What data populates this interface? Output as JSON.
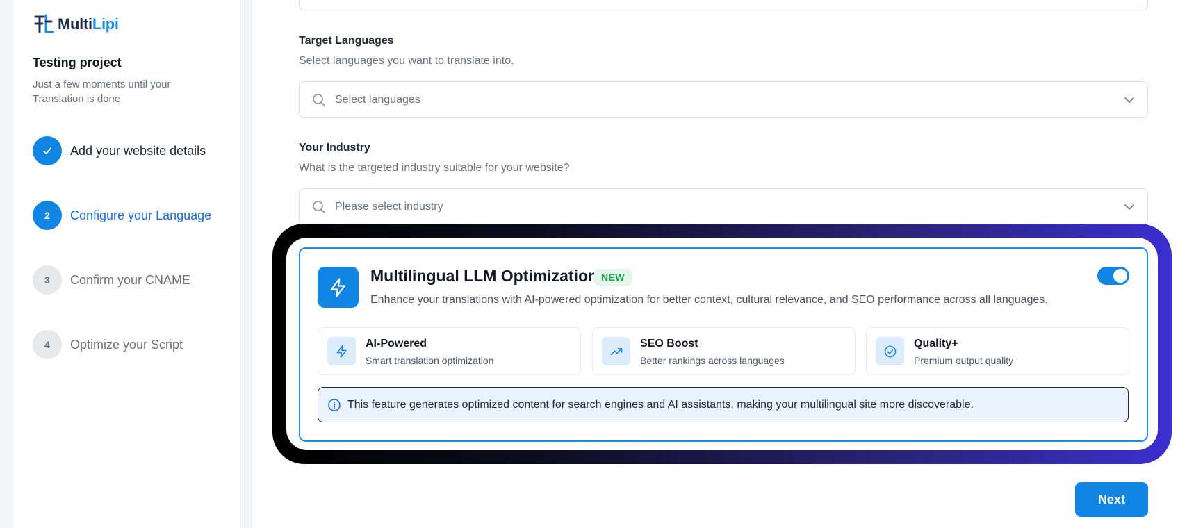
{
  "brand": {
    "multi": "Multi",
    "lipi": "Lipi"
  },
  "project": {
    "title": "Testing project",
    "subtitle": "Just a few moments until your Translation is done"
  },
  "steps": [
    {
      "number": "✓",
      "label": "Add your website details",
      "state": "done"
    },
    {
      "number": "2",
      "label": "Configure your Language",
      "state": "active"
    },
    {
      "number": "3",
      "label": "Confirm your CNAME",
      "state": "todo"
    },
    {
      "number": "4",
      "label": "Optimize your Script",
      "state": "todo"
    }
  ],
  "target_languages": {
    "label": "Target Languages",
    "help": "Select languages you want to translate into.",
    "placeholder": "Select languages"
  },
  "industry": {
    "label": "Your Industry",
    "help": "What is the targeted industry suitable for your website?",
    "placeholder": "Please select industry"
  },
  "llm_card": {
    "title": "Multilingual LLM Optimization",
    "badge": "NEW",
    "description": "Enhance your translations with AI-powered optimization for better context, cultural relevance, and SEO performance across all languages.",
    "enabled": true,
    "features": [
      {
        "icon": "bolt-icon",
        "title": "AI-Powered",
        "subtitle": "Smart translation optimization"
      },
      {
        "icon": "trending-up-icon",
        "title": "SEO Boost",
        "subtitle": "Better rankings across languages"
      },
      {
        "icon": "check-circle-icon",
        "title": "Quality+",
        "subtitle": "Premium output quality"
      }
    ],
    "info": "This feature generates optimized content for search engines and AI assistants, making your multilingual site more discoverable."
  },
  "actions": {
    "next_label": "Next"
  },
  "colors": {
    "primary": "#1185e4",
    "accent_text": "#1a6fe0",
    "new_badge": "#16a34a"
  }
}
